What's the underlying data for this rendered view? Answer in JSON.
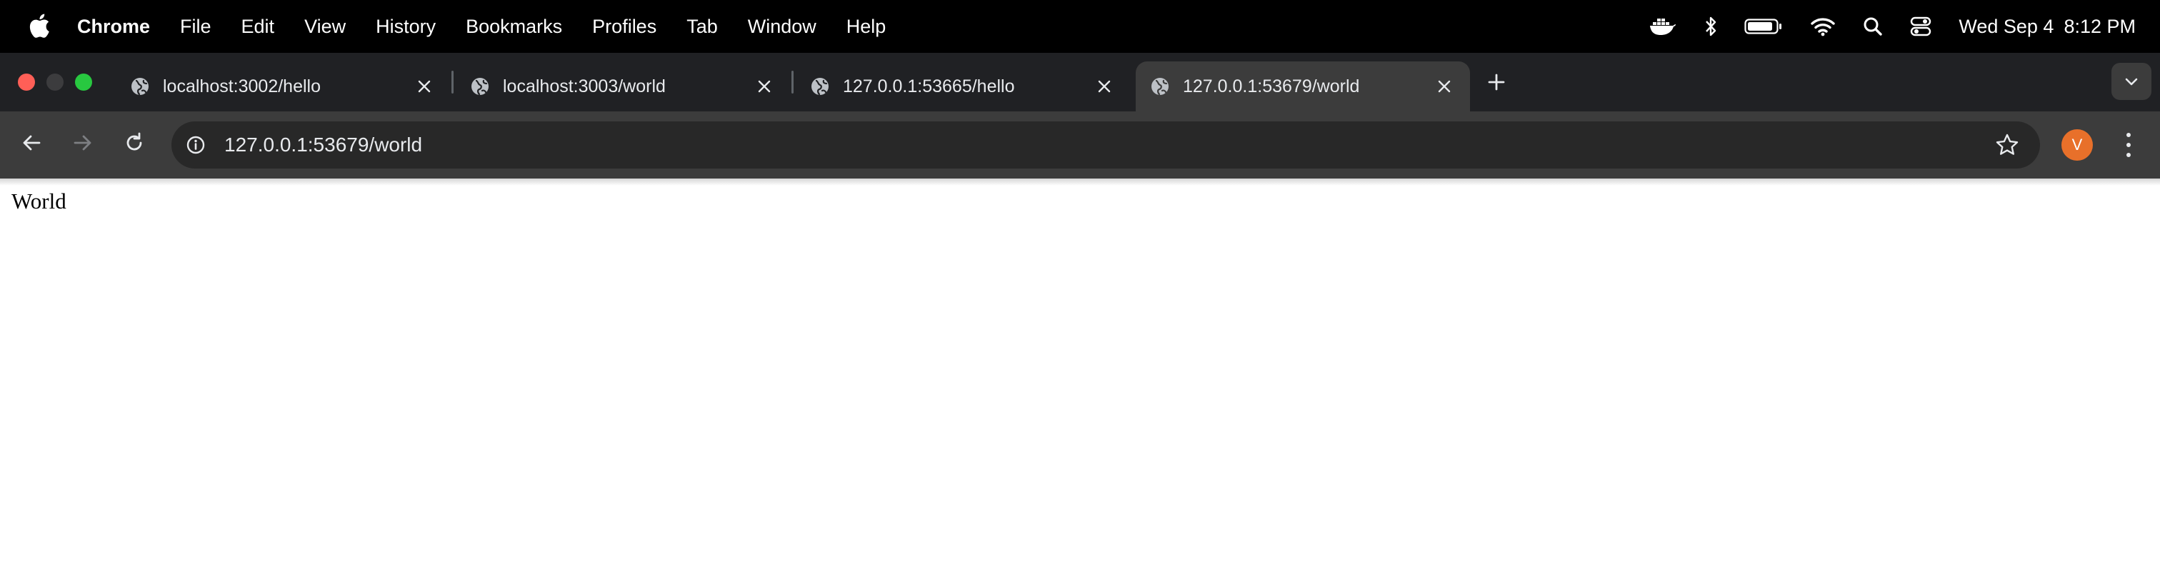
{
  "menubar": {
    "apple_icon": "apple-logo-icon",
    "items": [
      "Chrome",
      "File",
      "Edit",
      "View",
      "History",
      "Bookmarks",
      "Profiles",
      "Tab",
      "Window",
      "Help"
    ],
    "status_icons": [
      "docker-icon",
      "bluetooth-icon",
      "battery-icon",
      "wifi-icon",
      "spotlight-search-icon",
      "control-center-icon"
    ],
    "date": "Wed Sep 4",
    "time": "8:12 PM"
  },
  "tabs": [
    {
      "title": "localhost:3002/hello",
      "active": false
    },
    {
      "title": "localhost:3003/world",
      "active": false
    },
    {
      "title": "127.0.0.1:53665/hello",
      "active": false
    },
    {
      "title": "127.0.0.1:53679/world",
      "active": true
    }
  ],
  "toolbar": {
    "url": "127.0.0.1:53679/world",
    "avatar_letter": "V",
    "avatar_color": "#e8702a"
  },
  "page": {
    "text": "World"
  }
}
